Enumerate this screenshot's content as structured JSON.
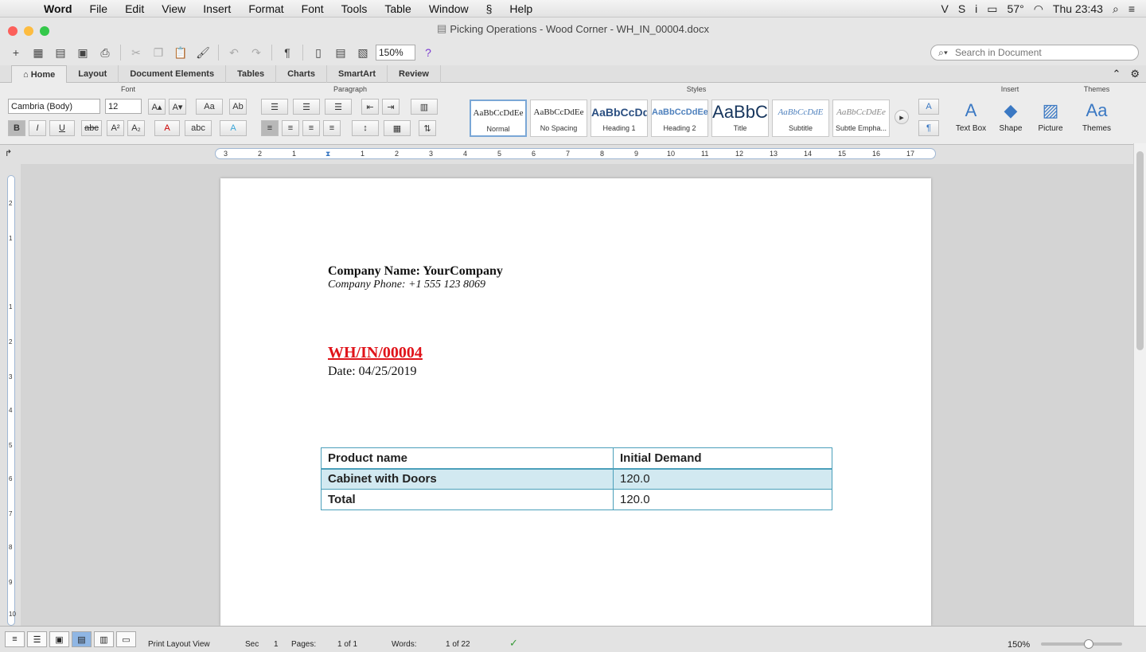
{
  "menubar": {
    "app": "Word",
    "items": [
      "File",
      "Edit",
      "View",
      "Insert",
      "Format",
      "Font",
      "Tools",
      "Table",
      "Window",
      "Help"
    ],
    "temp": "57°",
    "clock": "Thu 23:43"
  },
  "window": {
    "title": "Picking Operations - Wood Corner - WH_IN_00004.docx"
  },
  "toolbar": {
    "zoom": "150%",
    "search_placeholder": "Search in Document"
  },
  "ribbon": {
    "tabs": [
      "Home",
      "Layout",
      "Document Elements",
      "Tables",
      "Charts",
      "SmartArt",
      "Review"
    ],
    "groups": {
      "font": "Font",
      "paragraph": "Paragraph",
      "styles": "Styles",
      "insert": "Insert",
      "themes": "Themes"
    },
    "font_name": "Cambria (Body)",
    "font_size": "12",
    "styles": [
      {
        "preview": "AaBbCcDdEe",
        "name": "Normal"
      },
      {
        "preview": "AaBbCcDdEe",
        "name": "No Spacing"
      },
      {
        "preview": "AaBbCcDd",
        "name": "Heading 1"
      },
      {
        "preview": "AaBbCcDdEe",
        "name": "Heading 2"
      },
      {
        "preview": "AaBbC",
        "name": "Title"
      },
      {
        "preview": "AaBbCcDdE",
        "name": "Subtitle"
      },
      {
        "preview": "AaBbCcDdEe",
        "name": "Subtle Empha..."
      }
    ],
    "insert_items": [
      "Text Box",
      "Shape",
      "Picture"
    ],
    "themes_label": "Themes"
  },
  "document": {
    "company_name": "Company Name: YourCompany",
    "company_phone": "Company Phone: +1 555 123 8069",
    "reference": "WH/IN/00004",
    "date": "Date: 04/25/2019",
    "table": {
      "headers": [
        "Product name",
        "Initial Demand"
      ],
      "rows": [
        [
          "Cabinet with Doors",
          "120.0"
        ],
        [
          "Total",
          "120.0"
        ]
      ]
    }
  },
  "status": {
    "view": "Print Layout View",
    "sec_label": "Sec",
    "sec_value": "1",
    "pages_label": "Pages:",
    "pages_value": "1 of 1",
    "words_label": "Words:",
    "words_value": "1 of 22",
    "zoom": "150%"
  }
}
